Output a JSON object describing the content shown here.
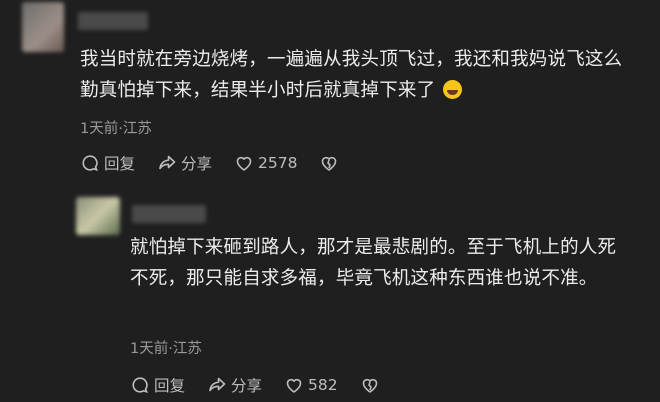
{
  "comments": [
    {
      "text": "我当时就在旁边烧烤，一遍遍从我头顶飞过，我还和我妈说飞这么勤真怕掉下来，结果半小时后就真掉下来了",
      "emoji_icon": "laughing-tears-emoji-icon",
      "meta": "1天前·江苏",
      "reply_label": "回复",
      "share_label": "分享",
      "like_count": "2578"
    },
    {
      "text": "就怕掉下来砸到路人，那才是最悲剧的。至于飞机上的人死不死，那只能自求多福，毕竟飞机这种东西谁也说不准。",
      "meta": "1天前·江苏",
      "reply_label": "回复",
      "share_label": "分享",
      "like_count": "582"
    }
  ],
  "colors": {
    "background": "#1f1f1f",
    "text": "#ececec",
    "meta": "#9a9a9a",
    "action": "#bdbdbd"
  }
}
